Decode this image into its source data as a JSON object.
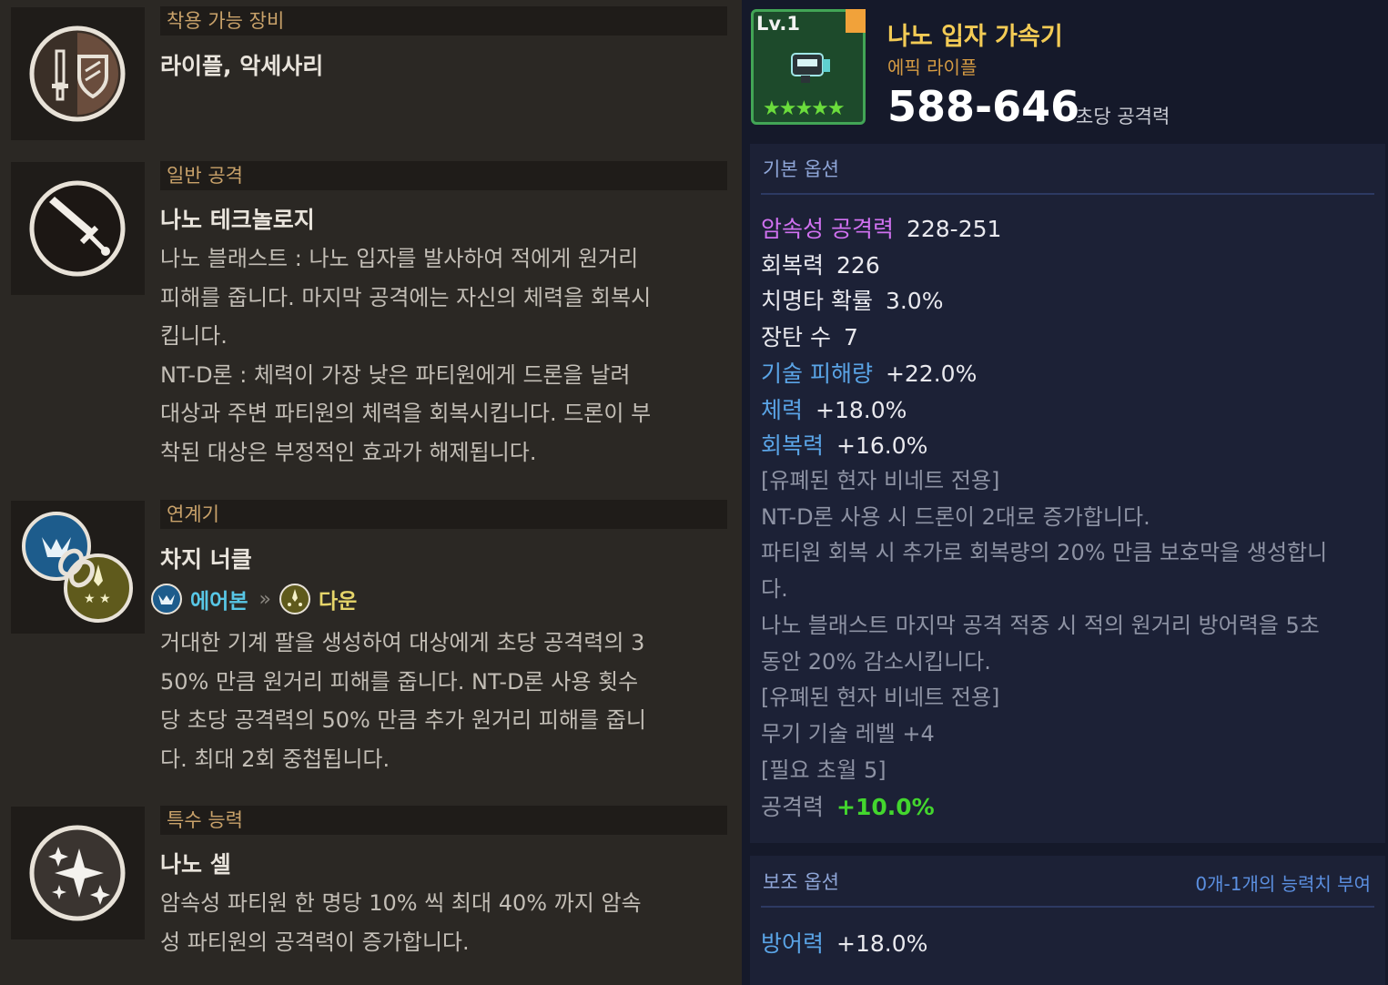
{
  "left": {
    "equip": {
      "header": "착용 가능 장비",
      "title": "라이플, 악세사리",
      "icon": "sword-shield-icon"
    },
    "normal_attack": {
      "header": "일반 공격",
      "title": "나노 테크놀로지",
      "icon": "sword-icon",
      "lines": [
        "나노 블래스트 : 나노 입자를 발사하여 적에게 원거리",
        "피해를 줍니다. 마지막 공격에는 자신의 체력을 회복시",
        "킵니다.",
        "NT-D론 : 체력이 가장 낮은 파티원에게 드론을 날려",
        "대상과 주변 파티원의 체력을 회복시킵니다. 드론이 부",
        "착된 대상은 부정적인 효과가 해제됩니다."
      ]
    },
    "chain": {
      "header": "연계기",
      "title": "차지 너클",
      "icon": "chain-link-icon",
      "from": "에어본",
      "arrow": "»",
      "to": "다운",
      "lines": [
        "거대한 기계 팔을 생성하여 대상에게 초당 공격력의 3",
        "50% 만큼 원거리 피해를 줍니다. NT-D론 사용 횟수",
        "당 초당 공격력의 50% 만큼 추가 원거리 피해를 줍니",
        "다. 최대 2회 중첩됩니다."
      ]
    },
    "special": {
      "header": "특수 능력",
      "title": "나노 셀",
      "icon": "sparkle-icon",
      "lines": [
        "암속성 파티원 한 명당 10% 씩 최대 40% 까지 암속",
        "성 파티원의 공격력이 증가합니다."
      ]
    }
  },
  "item": {
    "level": "Lv.1",
    "stars": "★★★★★",
    "name": "나노 입자 가속기",
    "type": "에픽 라이플",
    "dps": "588-646",
    "dps_label": "초당 공격력"
  },
  "basic_options": {
    "header": "기본 옵션",
    "stats": [
      {
        "k": "암속성 공격력",
        "v": "228-251",
        "color": "#d071f0"
      },
      {
        "k": "회복력",
        "v": "226",
        "color": "#e9e9ee"
      },
      {
        "k": "치명타 확률",
        "v": "3.0%",
        "color": "#e9e9ee"
      },
      {
        "k": "장탄 수",
        "v": "7",
        "color": "#e9e9ee"
      },
      {
        "k": "기술 피해량",
        "v": "+22.0%",
        "color": "#5aa4e6"
      },
      {
        "k": "체력",
        "v": "+18.0%",
        "color": "#5aa4e6"
      },
      {
        "k": "회복력",
        "v": "+16.0%",
        "color": "#5aa4e6"
      }
    ],
    "notes": [
      "[유폐된 현자 비네트 전용]",
      "NT-D론 사용 시 드론이 2대로 증가합니다.",
      "파티원 회복 시 추가로 회복량의  20% 만큼 보호막을 생성합니",
      "다.",
      "나노 블래스트 마지막 공격 적중 시 적의 원거리 방어력을 5초",
      "동안 20% 감소시킵니다.",
      "[유폐된 현자 비네트 전용]",
      "무기 기술 레벨 +4",
      "[필요 초월 5]"
    ],
    "bonus": {
      "k": "공격력",
      "v": "+10.0%",
      "vcolor": "#43d62e"
    }
  },
  "sub_options": {
    "header": "보조 옵션",
    "right": "0개-1개의 능력치 부여",
    "stat": {
      "k": "방어력",
      "v": "+18.0%",
      "color": "#5aa4e6"
    }
  }
}
